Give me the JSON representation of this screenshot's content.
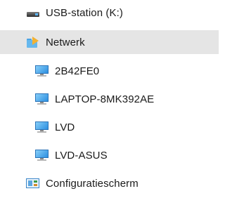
{
  "nav_pane": {
    "items": [
      {
        "label": "USB-station (K:)",
        "icon": "usb-drive-icon",
        "selected": false
      },
      {
        "label": "Netwerk",
        "icon": "network-icon",
        "selected": true
      },
      {
        "label": "2B42FE0",
        "icon": "computer-icon",
        "selected": false
      },
      {
        "label": "LAPTOP-8MK392AE",
        "icon": "computer-icon",
        "selected": false
      },
      {
        "label": "LVD",
        "icon": "computer-icon",
        "selected": false
      },
      {
        "label": "LVD-ASUS",
        "icon": "computer-icon",
        "selected": false
      },
      {
        "label": "Configuratiescherm",
        "icon": "control-panel-icon",
        "selected": false
      }
    ]
  },
  "colors": {
    "selected_row_background": "#e5e5e5",
    "text": "#1a1a1a"
  }
}
